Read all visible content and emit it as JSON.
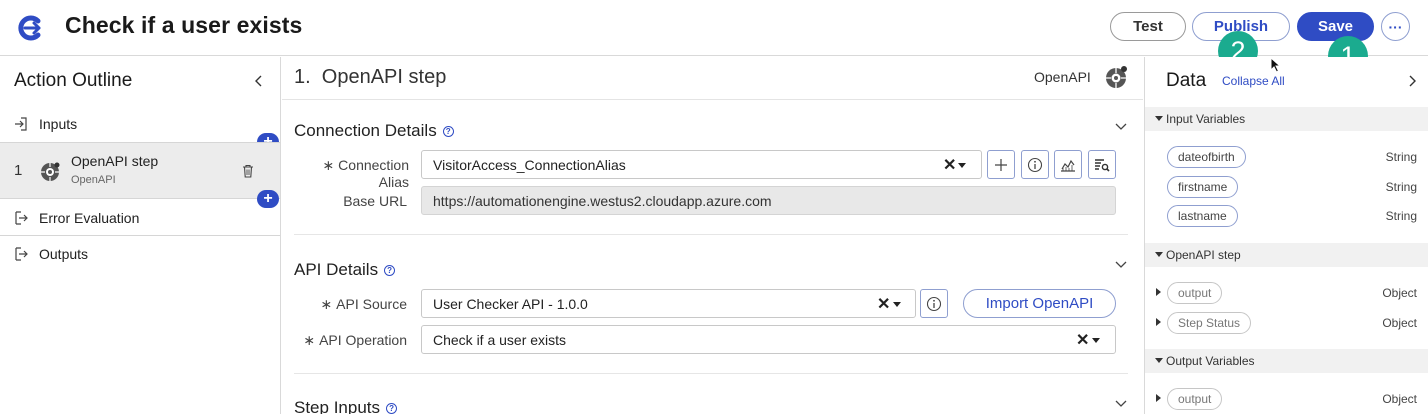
{
  "header": {
    "title": "Check if a user exists",
    "test_label": "Test",
    "publish_label": "Publish",
    "save_label": "Save",
    "more_label": "···",
    "badge_publish": "2",
    "badge_save": "1"
  },
  "outline": {
    "title": "Action Outline",
    "items": {
      "inputs": "Inputs",
      "error": "Error Evaluation",
      "outputs": "Outputs"
    },
    "step": {
      "number": "1",
      "name": "OpenAPI step",
      "type": "OpenAPI"
    },
    "add_symbol": "+"
  },
  "step": {
    "title": "1.  OpenAPI step",
    "provider": "OpenAPI",
    "connection": {
      "title": "Connection Details",
      "alias_label": "Connection Alias",
      "alias_value": "VisitorAccess_ConnectionAlias",
      "base_url_label": "Base URL",
      "base_url_value": "https://automationengine.westus2.cloudapp.azure.com"
    },
    "api": {
      "title": "API Details",
      "source_label": "API Source",
      "source_value": "User Checker API - 1.0.0",
      "operation_label": "API Operation",
      "operation_value": "Check if a user exists",
      "import_label": "Import OpenAPI"
    },
    "inputs_title": "Step Inputs",
    "required_mark": "∗",
    "clear_mark": "✕",
    "help_mark": "?"
  },
  "data_panel": {
    "title": "Data",
    "collapse_all": "Collapse All",
    "groups": {
      "input_variables": {
        "title": "Input Variables",
        "items": [
          {
            "name": "dateofbirth",
            "type": "String"
          },
          {
            "name": "firstname",
            "type": "String"
          },
          {
            "name": "lastname",
            "type": "String"
          }
        ]
      },
      "openapi_step": {
        "title": "OpenAPI step",
        "items": [
          {
            "name": "output",
            "type": "Object"
          },
          {
            "name": "Step Status",
            "type": "Object"
          }
        ]
      },
      "output_variables": {
        "title": "Output Variables",
        "items": [
          {
            "name": "output",
            "type": "Object"
          }
        ]
      }
    }
  },
  "colors": {
    "primary": "#2f4cc4",
    "badge": "#1bab8f"
  }
}
